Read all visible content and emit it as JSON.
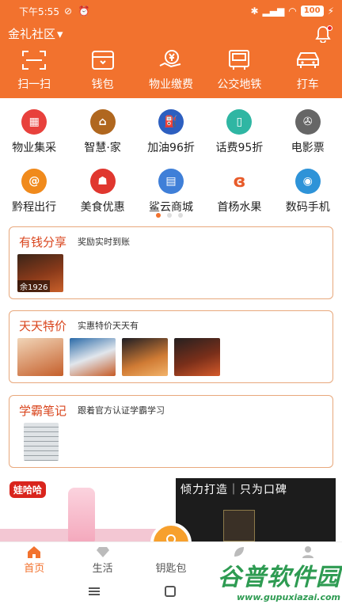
{
  "status_bar": {
    "time": "下午5:55",
    "battery": "100"
  },
  "header": {
    "community": "金礼社区",
    "quick": [
      "扫一扫",
      "钱包",
      "物业缴费",
      "公交地铁",
      "打车"
    ]
  },
  "services": [
    {
      "label": "物业集采",
      "icon": "grid-icon",
      "color": "#e8413c"
    },
    {
      "label": "智慧·家",
      "icon": "home-icon",
      "color": "#b0671f"
    },
    {
      "label": "加油96折",
      "icon": "gas-icon",
      "color": "#2d5fc0"
    },
    {
      "label": "话费95折",
      "icon": "phone-icon",
      "color": "#2fb6a3"
    },
    {
      "label": "电影票",
      "icon": "film-icon",
      "color": "#666666"
    },
    {
      "label": "黔程出行",
      "icon": "travel-icon",
      "color": "#f08a1c"
    },
    {
      "label": "美食优惠",
      "icon": "food-icon",
      "color": "#e0372f"
    },
    {
      "label": "鲨云商城",
      "icon": "shop-icon",
      "color": "#3f7fd8"
    },
    {
      "label": "首杨水果",
      "icon": "fruit-icon",
      "color": "#e85b2a"
    },
    {
      "label": "数码手机",
      "icon": "camera-icon",
      "color": "#2e93d8"
    }
  ],
  "cards": {
    "money": {
      "title": "有钱分享",
      "subtitle": "奖励实时到账",
      "badge": "余1926"
    },
    "daily": {
      "title": "天天特价",
      "subtitle": "实惠特价天天有"
    },
    "study": {
      "title": "学霸笔记",
      "subtitle": "跟着官方认证学霸学习"
    }
  },
  "promo": {
    "brand": "娃哈哈",
    "slogan": "倾力打造｜只为口碑"
  },
  "tabs": [
    "首页",
    "生活",
    "钥匙包",
    "",
    ""
  ],
  "watermark": {
    "line1": "谷普软件园",
    "line2": "www.gupuxiazai.com"
  }
}
